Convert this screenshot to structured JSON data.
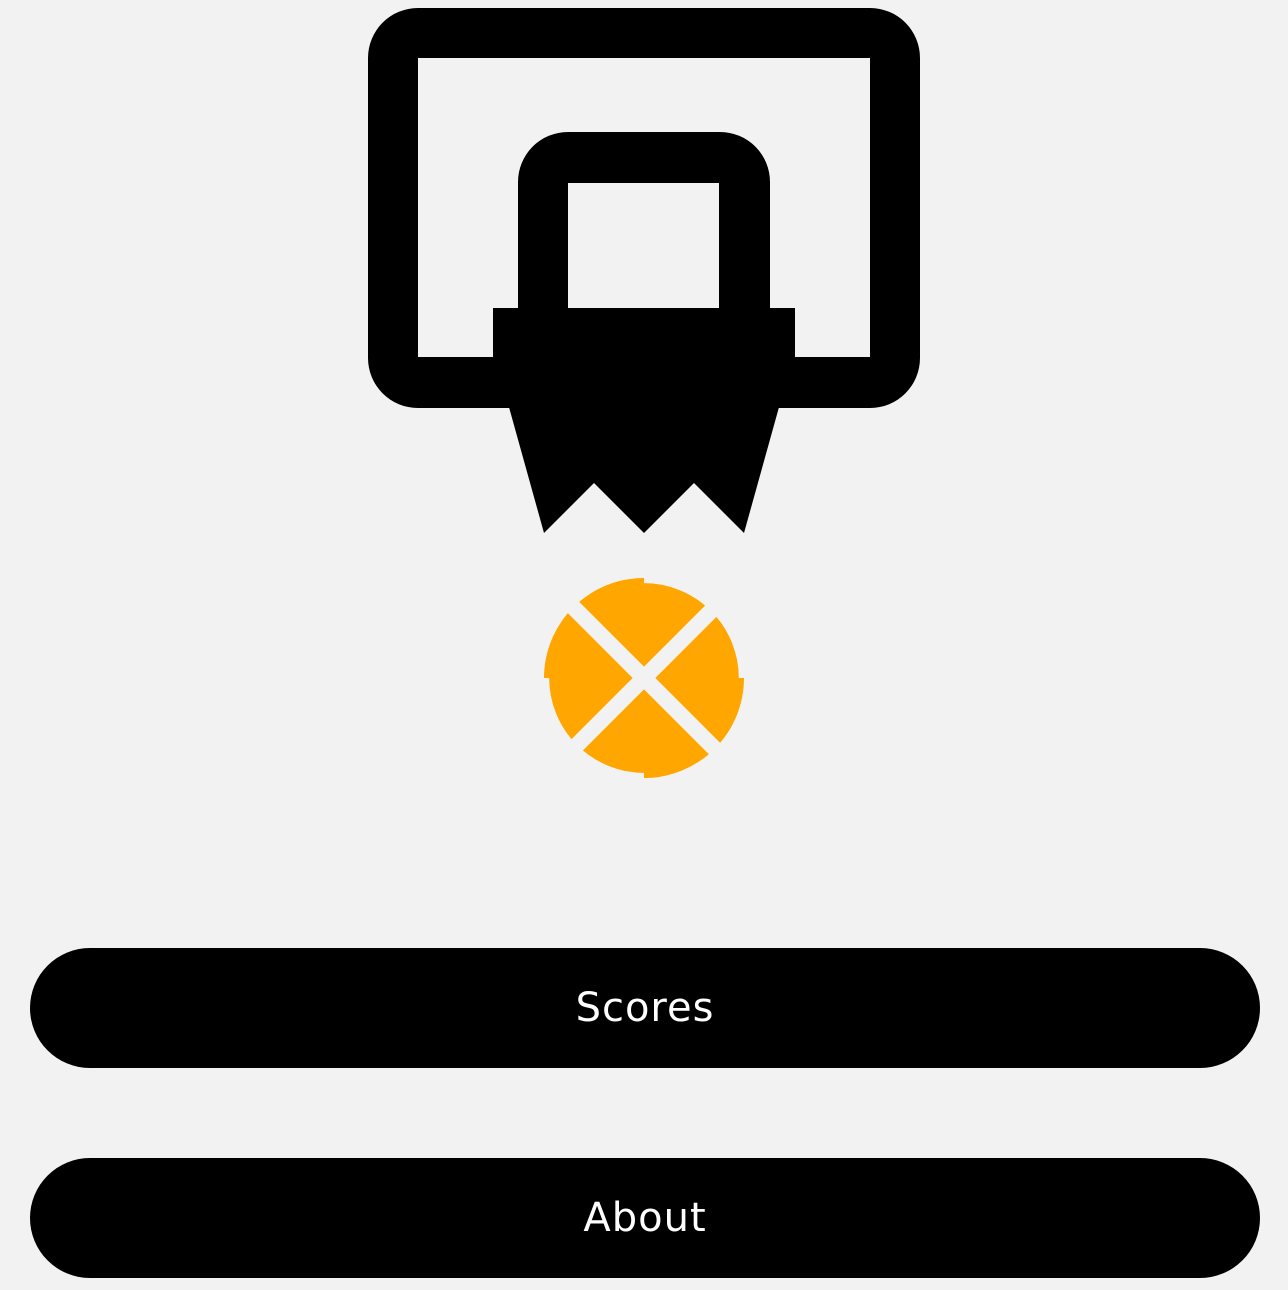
{
  "colors": {
    "background": "#f2f2f2",
    "hoop": "#000000",
    "ball": "#ffa600",
    "button_bg": "#000000",
    "button_text": "#ffffff"
  },
  "icons": {
    "hoop": "basketball-hoop-icon",
    "ball": "basketball-icon"
  },
  "menu": {
    "scores_label": "Scores",
    "about_label": "About"
  }
}
